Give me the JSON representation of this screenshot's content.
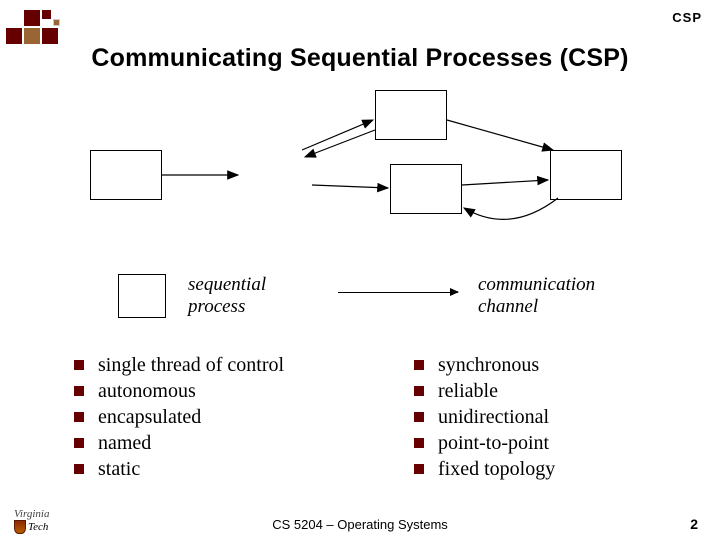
{
  "header": {
    "corner_label": "CSP"
  },
  "title": "Communicating Sequential Processes (CSP)",
  "legend": {
    "left_label": "sequential\nprocess",
    "right_label": "communication\nchannel"
  },
  "left_list": [
    "single thread of control",
    "autonomous",
    "encapsulated",
    "named",
    "static"
  ],
  "right_list": [
    "synchronous",
    "reliable",
    "unidirectional",
    "point-to-point",
    "fixed topology"
  ],
  "footer": {
    "course": "CS 5204 – Operating Systems",
    "page": "2",
    "university_top": "Virginia",
    "university_bot": "Tech"
  },
  "logo_colors": {
    "dark": "#660000",
    "mid": "#996633",
    "lite": "#ffffff"
  }
}
